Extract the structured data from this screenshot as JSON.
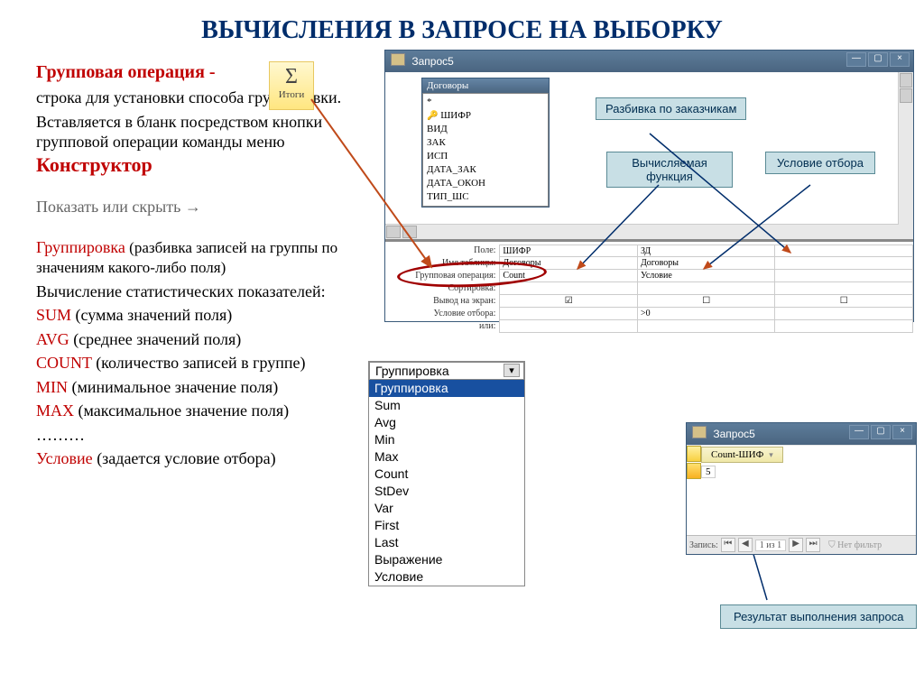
{
  "title": "ВЫЧИСЛЕНИЯ В ЗАПРОСЕ НА ВЫБОРКУ",
  "para": {
    "group_op": "Групповая операция -",
    "group_op_desc1": "строка для установки способа группировки.",
    "group_op_desc2": "Вставляется в бланк посредством кнопки групповой операции команды меню ",
    "constructor": "Конструктор",
    "show_hide": "Показать или скрыть →",
    "grouping": "Группировка",
    "grouping_desc": " (разбивка записей на группы по значениям какого-либо поля)",
    "stat_head": "Вычисление статистических показателей:",
    "sum": "SUM",
    "sum_d": " (сумма значений поля)",
    "avg": "AVG",
    "avg_d": " (среднее значений поля)",
    "count": "COUNT",
    "count_d": " (количество записей в группе)",
    "min": "MIN",
    "min_d": " (минимальное значение поля)",
    "max": "MAX",
    "max_d": " (максимальное значение поля)",
    "dots": "………",
    "cond": "Условие",
    "cond_d": " (задается условие отбора)"
  },
  "sigma": {
    "symbol": "Σ",
    "label": "Итоги"
  },
  "win_title": "Запрос5",
  "table_panel": {
    "name": "Договоры",
    "fields": [
      "*",
      "ШИФР",
      "ВИД",
      "ЗАК",
      "ИСП",
      "ДАТА_ЗАК",
      "ДАТА_ОКОН",
      "ТИП_ШС"
    ]
  },
  "callouts": {
    "c1": "Разбивка по заказчикам",
    "c2": "Вычисляемая функция",
    "c3": "Условие отбора",
    "result": "Результат выполнения запроса"
  },
  "grid": {
    "r_pole": "Поле:",
    "r_tab": "Имя таблицы:",
    "r_grp": "Групповая операция:",
    "r_sort": "Сортировка:",
    "r_show": "Вывод на экран:",
    "r_cond": "Условие отбора:",
    "r_or": "или:",
    "col1": {
      "pole": "ШИФР",
      "tab": "Договоры",
      "grp": "Count",
      "cond": ""
    },
    "col2": {
      "pole": "ЗД",
      "tab": "Договоры",
      "grp": "Условие",
      "cond": ">0"
    }
  },
  "dropdown": {
    "head": "Группировка",
    "items": [
      "Группировка",
      "Sum",
      "Avg",
      "Min",
      "Max",
      "Count",
      "StDev",
      "Var",
      "First",
      "Last",
      "Выражение",
      "Условие"
    ]
  },
  "result_win": {
    "title": "Запрос5",
    "col": "Count-ШИФ",
    "val": "5",
    "nav_label": "Запись:",
    "nav_pos": "1 из 1",
    "filter": "Нет фильтр"
  }
}
